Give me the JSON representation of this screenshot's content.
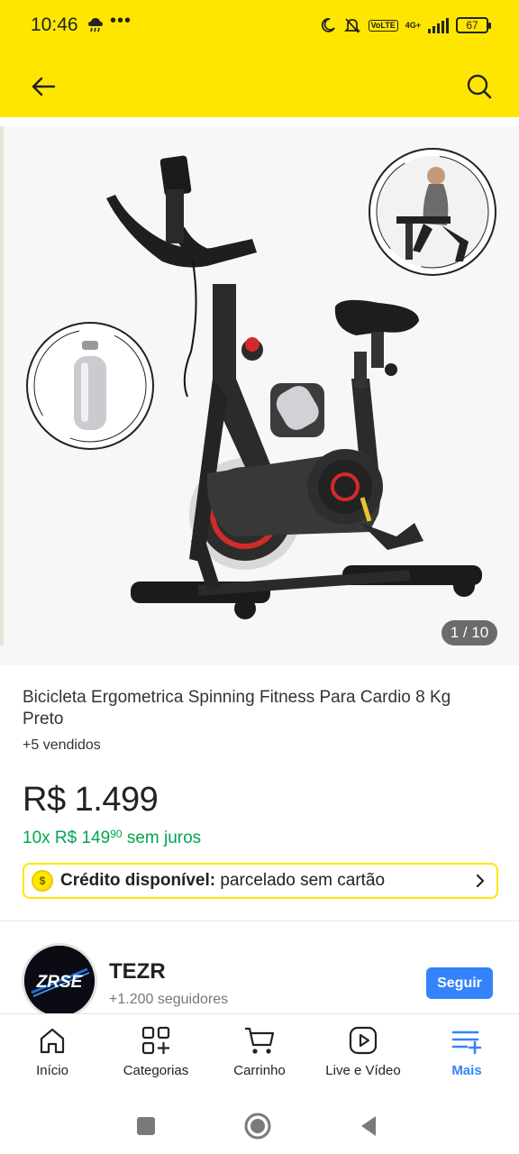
{
  "status_bar": {
    "time": "10:46",
    "more": "•••",
    "network": "4G+",
    "lte": "VoLTE",
    "battery": "67"
  },
  "product": {
    "title": "Bicicleta Ergometrica Spinning Fitness Para Cardio 8 Kg Preto",
    "sold": "+5 vendidos",
    "price": "R$ 1.499",
    "installments_prefix": "10x R$ 149",
    "installments_cents": "90",
    "installments_suffix": "sem juros",
    "credit_label": "Crédito disponível:",
    "credit_text": "parcelado sem cartão",
    "image_index": "1 / 10"
  },
  "seller": {
    "name": "TEZR",
    "followers": "+1.200 seguidores",
    "follow_label": "Seguir",
    "logo_text": "ZRSE"
  },
  "nav": {
    "items": [
      {
        "label": "Início",
        "icon": "home-icon"
      },
      {
        "label": "Categorias",
        "icon": "categories-icon"
      },
      {
        "label": "Carrinho",
        "icon": "cart-icon"
      },
      {
        "label": "Live e Vídeo",
        "icon": "play-icon"
      },
      {
        "label": "Mais",
        "icon": "menu-plus-icon"
      }
    ],
    "active_index": 4
  },
  "colors": {
    "brand_yellow": "#ffe600",
    "accent_blue": "#3483fa",
    "green": "#00a650"
  }
}
